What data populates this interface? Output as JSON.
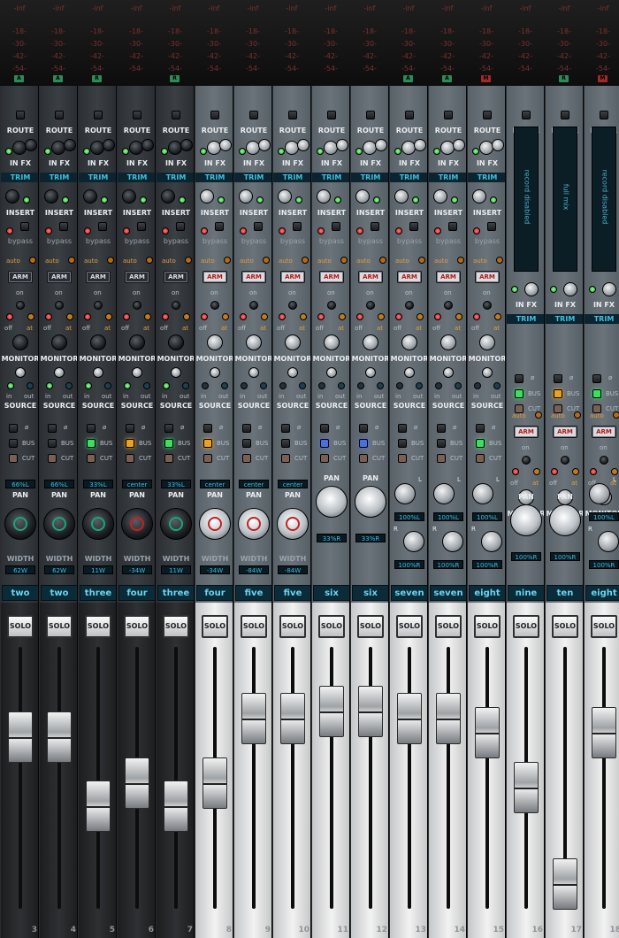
{
  "meter_scale": [
    "-inf",
    "-18-",
    "-30-",
    "-42-",
    "-54-"
  ],
  "channels": [
    {
      "name": "two",
      "num": "",
      "tag": "A",
      "tagc": "g",
      "theme": "dark",
      "pan": "66%L",
      "width": "62W",
      "knob": "green",
      "fader": 0.28,
      "bus": false,
      "busc": ""
    },
    {
      "name": "two",
      "num": "",
      "tag": "A",
      "tagc": "g",
      "theme": "dark",
      "pan": "66%L",
      "width": "62W",
      "knob": "green",
      "fader": 0.28,
      "bus": false,
      "busc": ""
    },
    {
      "name": "three",
      "num": "",
      "tag": "R",
      "tagc": "g",
      "theme": "dark",
      "pan": "33%L",
      "width": "11W",
      "knob": "green",
      "fader": 0.58,
      "bus": true,
      "busc": "green"
    },
    {
      "name": "four",
      "num": "",
      "tag": "",
      "tagc": "g",
      "theme": "dark",
      "pan": "center",
      "width": "-34W",
      "knob": "red",
      "fader": 0.48,
      "bus": true,
      "busc": "orange"
    },
    {
      "name": "three",
      "num": "",
      "tag": "R",
      "tagc": "g",
      "theme": "dark",
      "pan": "33%L",
      "width": "11W",
      "knob": "green",
      "fader": 0.58,
      "bus": true,
      "busc": "green"
    },
    {
      "name": "four",
      "num": "8",
      "tag": "",
      "tagc": "g",
      "theme": "light",
      "pan": "center",
      "width": "-34W",
      "knob": "red",
      "fader": 0.48,
      "bus": true,
      "busc": "orange"
    },
    {
      "name": "five",
      "num": "9",
      "tag": "",
      "tagc": "g",
      "theme": "light",
      "pan": "center",
      "width": "-84W",
      "knob": "red",
      "fader": 0.2,
      "bus": false,
      "busc": ""
    },
    {
      "name": "five",
      "num": "10",
      "tag": "",
      "tagc": "g",
      "theme": "light",
      "pan": "center",
      "width": "-84W",
      "knob": "red",
      "fader": 0.2,
      "bus": false,
      "busc": ""
    },
    {
      "name": "six",
      "num": "11",
      "tag": "",
      "tagc": "g",
      "theme": "light",
      "pan": "33%R",
      "width": "",
      "knob": "",
      "fader": 0.17,
      "bus": false,
      "busc": "blue"
    },
    {
      "name": "six",
      "num": "12",
      "tag": "",
      "tagc": "g",
      "theme": "light",
      "pan": "33%R",
      "width": "",
      "knob": "",
      "fader": 0.17,
      "bus": false,
      "busc": "blue"
    },
    {
      "name": "seven",
      "num": "13",
      "tag": "A",
      "tagc": "g",
      "theme": "light",
      "pan": "100%L",
      "width": "100%R",
      "knob": "",
      "fader": 0.2,
      "bus": false,
      "busc": ""
    },
    {
      "name": "seven",
      "num": "14",
      "tag": "A",
      "tagc": "g",
      "theme": "light",
      "pan": "100%L",
      "width": "100%R",
      "knob": "",
      "fader": 0.2,
      "bus": false,
      "busc": ""
    },
    {
      "name": "eight",
      "num": "15",
      "tag": "M",
      "tagc": "r",
      "theme": "light",
      "pan": "100%L",
      "width": "100%R",
      "knob": "",
      "fader": 0.26,
      "bus": true,
      "busc": "green"
    },
    {
      "name": "nine",
      "num": "16",
      "tag": "",
      "tagc": "g",
      "theme": "light",
      "pan": "100%R",
      "width": "",
      "knob": "",
      "fader": 0.5,
      "bus": true,
      "busc": "green"
    },
    {
      "name": "ten",
      "num": "17",
      "tag": "R",
      "tagc": "g",
      "theme": "light",
      "pan": "100%R",
      "width": "",
      "knob": "",
      "fader": 0.92,
      "bus": true,
      "busc": "orange"
    },
    {
      "name": "eight",
      "num": "18",
      "tag": "M",
      "tagc": "r",
      "theme": "light",
      "pan": "100%L",
      "width": "100%R",
      "knob": "",
      "fader": 0.26,
      "bus": true,
      "busc": "green"
    }
  ],
  "labels": {
    "route": "ROUTE",
    "infx": "IN FX",
    "trim": "TRIM",
    "insert": "INSERT",
    "bypass": "bypass",
    "auto": "auto",
    "arm": "ARM",
    "on": "on",
    "off": "off",
    "at": "at",
    "monitor": "MONITOR",
    "in": "in",
    "out": "out",
    "source": "SOURCE",
    "phase": "ø",
    "bus": "BUS",
    "cut": "CUT",
    "pan": "PAN",
    "width": "WIDTH",
    "solo": "SOLO",
    "l": "L",
    "r": "R"
  },
  "displays": [
    "record disabled",
    "full mix",
    "record disabled"
  ],
  "extra_nums": [
    "3",
    "4",
    "5",
    "6",
    "7"
  ]
}
